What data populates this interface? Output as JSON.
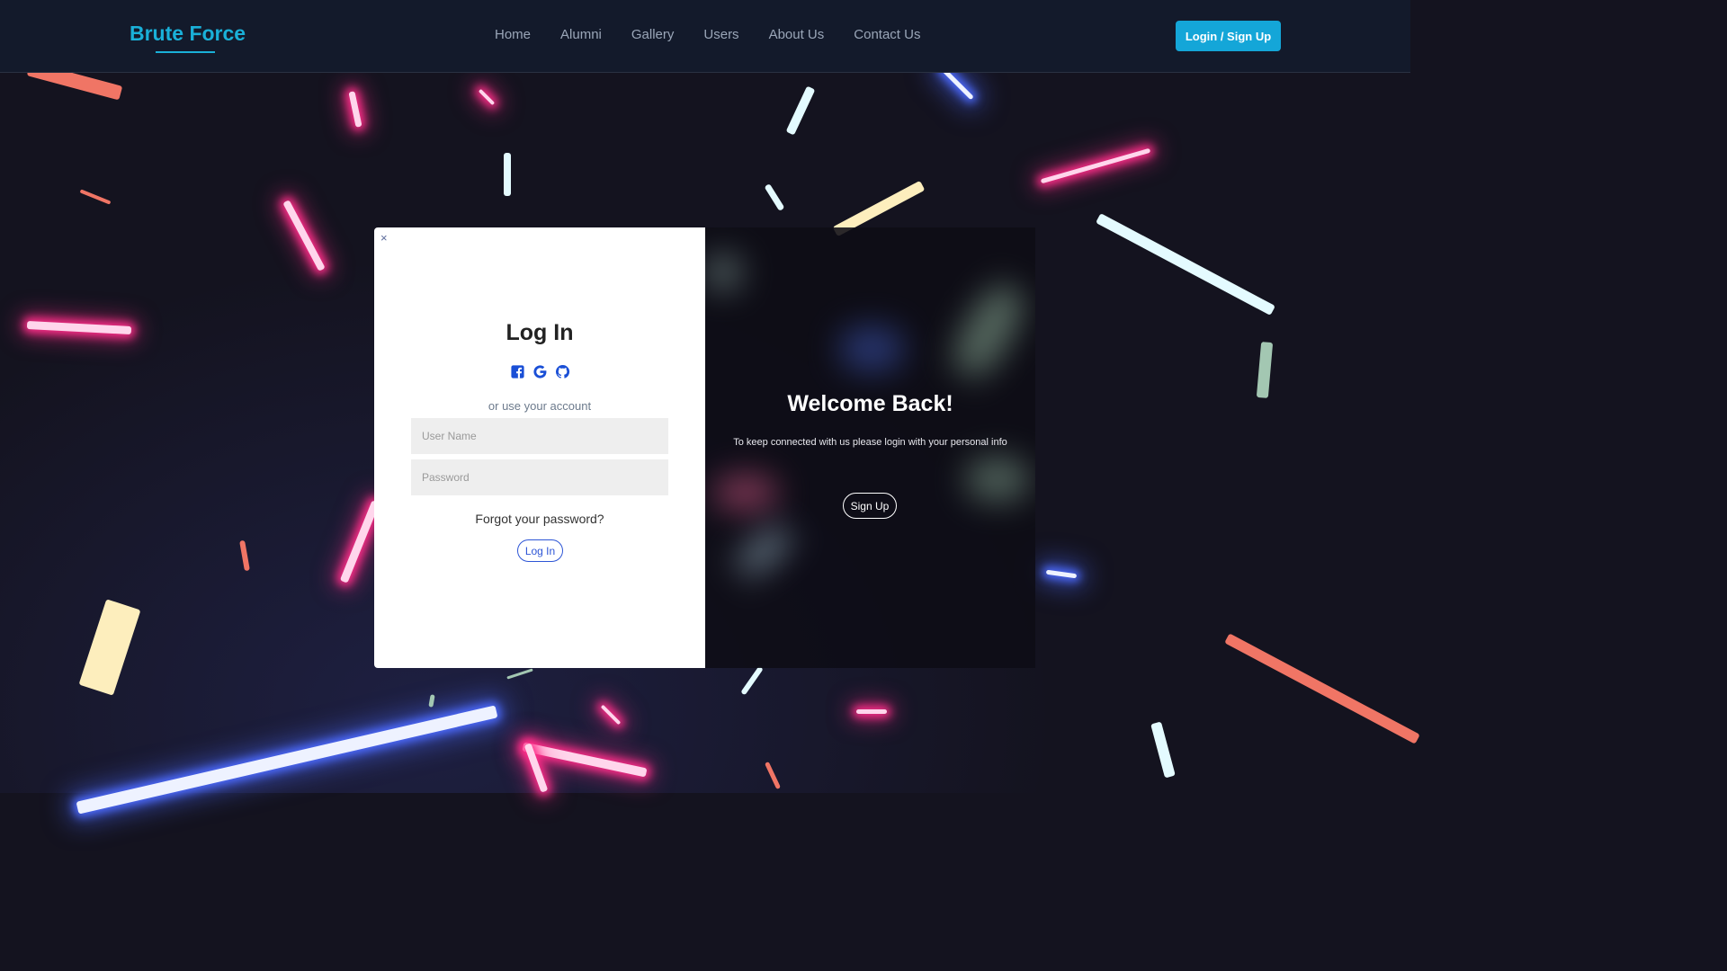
{
  "navbar": {
    "brand": "Brute Force",
    "links": [
      "Home",
      "Alumni",
      "Gallery",
      "Users",
      "About Us",
      "Contact Us"
    ],
    "cta_label": "Login / Sign Up"
  },
  "login": {
    "close_label": "×",
    "title": "Log In",
    "social_icons": [
      "facebook-icon",
      "google-icon",
      "github-icon"
    ],
    "or_text": "or use your account",
    "username_placeholder": "User Name",
    "password_placeholder": "Password",
    "forgot_text": "Forgot your password?",
    "submit_label": "Log In"
  },
  "overlay": {
    "title": "Welcome Back!",
    "subtitle": "To keep connected with us please login with your personal info",
    "signup_label": "Sign Up"
  },
  "colors": {
    "brand": "#1ab0d8",
    "cta": "#14a6d8",
    "link_accent": "#2d55d6",
    "background": "#14131f"
  }
}
